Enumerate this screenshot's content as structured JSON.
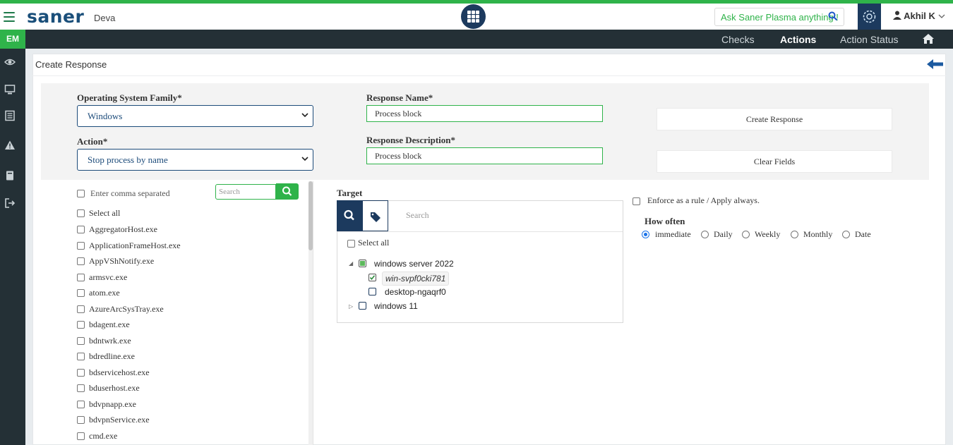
{
  "header": {
    "logo": "saner",
    "org_name": "Deva",
    "ask_placeholder": "Ask Saner Plasma anything !",
    "user_name": "Akhil K"
  },
  "nav": {
    "module_tab": "EM",
    "links": [
      "Checks",
      "Actions",
      "Action Status"
    ],
    "active": "Actions"
  },
  "sidebar_icons": [
    "eye-icon",
    "monitor-icon",
    "list-icon",
    "alert-icon",
    "book-icon",
    "logout-icon"
  ],
  "page": {
    "title": "Create Response"
  },
  "form": {
    "os_family_label": "Operating System Family*",
    "os_family_value": "Windows",
    "action_label": "Action*",
    "action_value": "Stop process by name",
    "response_name_label": "Response Name*",
    "response_name_value": "Process block",
    "response_desc_label": "Response Description*",
    "response_desc_value": "Process block",
    "create_button": "Create Response",
    "clear_button": "Clear Fields"
  },
  "process_list": {
    "comma_placeholder": "Enter comma separated",
    "search_placeholder": "Search",
    "select_all": "Select all",
    "items": [
      "AggregatorHost.exe",
      "ApplicationFrameHost.exe",
      "AppVShNotify.exe",
      "armsvc.exe",
      "atom.exe",
      "AzureArcSysTray.exe",
      "bdagent.exe",
      "bdntwrk.exe",
      "bdredline.exe",
      "bdservicehost.exe",
      "bduserhost.exe",
      "bdvpnapp.exe",
      "bdvpnService.exe",
      "cmd.exe"
    ]
  },
  "target": {
    "label": "Target",
    "search_placeholder": "Search",
    "select_all": "Select all",
    "groups": [
      {
        "name": "windows server 2022",
        "expanded": true,
        "state": "partial",
        "children": [
          {
            "name": "win-svpf0cki781",
            "checked": true
          },
          {
            "name": "desktop-ngaqrf0",
            "checked": false
          }
        ]
      },
      {
        "name": "windows 11",
        "expanded": false,
        "state": "unchecked",
        "children": []
      }
    ]
  },
  "schedule": {
    "enforce_label": "Enforce as a rule / Apply always.",
    "how_often_label": "How often",
    "options": [
      "immediate",
      "Daily",
      "Weekly",
      "Monthly",
      "Date"
    ],
    "selected": "immediate"
  },
  "colors": {
    "brand_green": "#2fb34a",
    "navy": "#1c3a5e",
    "nav_dark": "#243036"
  }
}
